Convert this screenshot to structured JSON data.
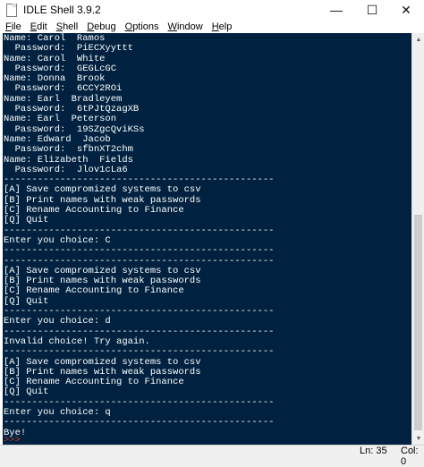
{
  "window": {
    "title": "IDLE Shell 3.9.2",
    "minimize_glyph": "—",
    "maximize_glyph": "☐",
    "close_glyph": "✕",
    "icon": "idle-page-icon"
  },
  "menu": [
    {
      "label": "File",
      "accel": "F",
      "rest": "ile"
    },
    {
      "label": "Edit",
      "accel": "E",
      "rest": "dit"
    },
    {
      "label": "Shell",
      "accel": "S",
      "rest": "hell"
    },
    {
      "label": "Debug",
      "accel": "D",
      "rest": "ebug"
    },
    {
      "label": "Options",
      "accel": "O",
      "rest": "ptions"
    },
    {
      "label": "Window",
      "accel": "W",
      "rest": "indow"
    },
    {
      "label": "Help",
      "accel": "H",
      "rest": "elp"
    }
  ],
  "shell": {
    "background": "#002240",
    "text_color": "#ffffff",
    "prompt_color": "#c0392b",
    "lines": [
      "Name: Carol  Ramos",
      "  Password:  PiECXyyttt",
      "Name: Carol  White",
      "  Password:  GEGLcGC",
      "Name: Donna  Brook",
      "  Password:  6CCY2ROi",
      "Name: Earl  Bradleyem",
      "  Password:  6tPJtQzagXB",
      "Name: Earl  Peterson",
      "  Password:  19SZgcQviKSs",
      "Name: Edward  Jacob",
      "  Password:  sfbnXT2chm",
      "Name: Elizabeth  Fields",
      "  Password:  Jlov1cLa6",
      "------------------------------------------------",
      "[A] Save compromized systems to csv",
      "[B] Print names with weak passwords",
      "[C] Rename Accounting to Finance",
      "[Q] Quit",
      "------------------------------------------------",
      "Enter you choice: C",
      "------------------------------------------------",
      "------------------------------------------------",
      "[A] Save compromized systems to csv",
      "[B] Print names with weak passwords",
      "[C] Rename Accounting to Finance",
      "[Q] Quit",
      "------------------------------------------------",
      "Enter you choice: d",
      "------------------------------------------------",
      "Invalid choice! Try again.",
      "------------------------------------------------",
      "[A] Save compromized systems to csv",
      "[B] Print names with weak passwords",
      "[C] Rename Accounting to Finance",
      "[Q] Quit",
      "------------------------------------------------",
      "Enter you choice: q",
      "------------------------------------------------",
      "Bye!"
    ],
    "prompt": ">>>"
  },
  "status": {
    "line": "Ln: 35",
    "col": "Col: 0"
  }
}
